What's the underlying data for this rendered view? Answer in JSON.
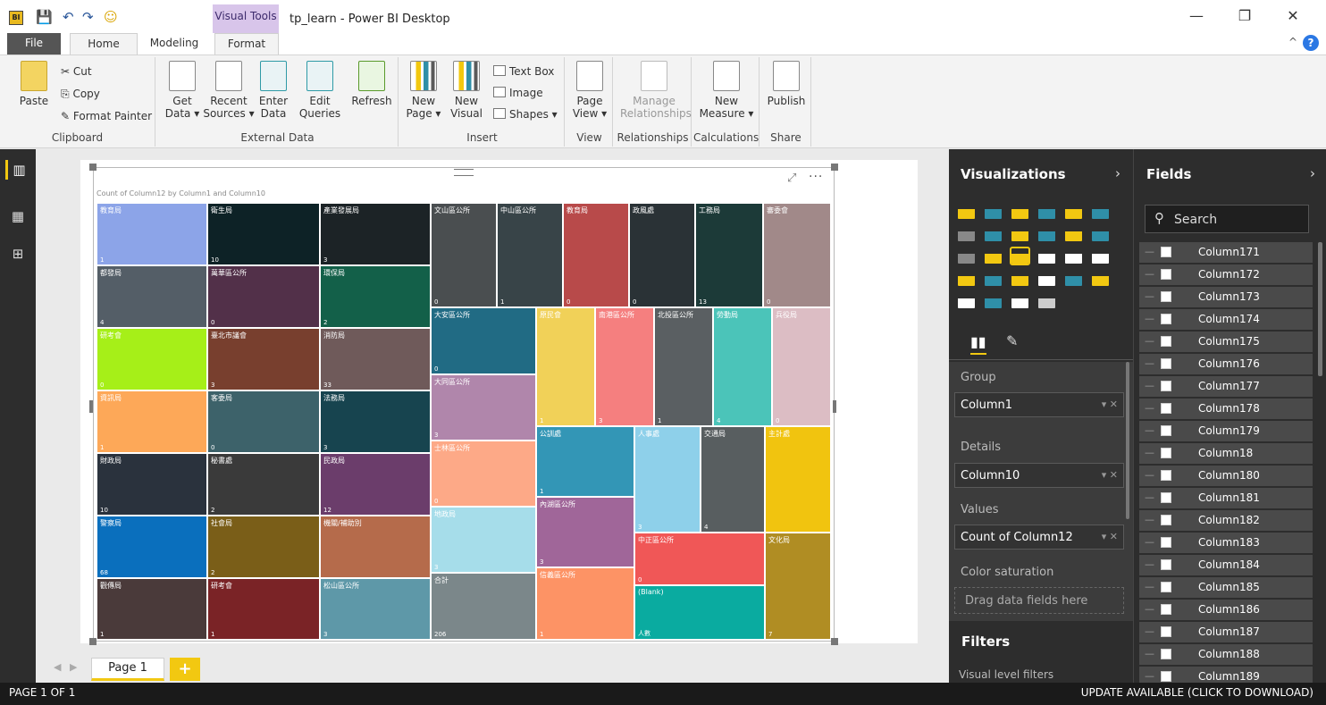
{
  "app": {
    "title": "tp_learn - Power BI Desktop",
    "contextual_tab": "Visual Tools"
  },
  "tabs": [
    "File",
    "Home",
    "Modeling",
    "Format"
  ],
  "ribbon": {
    "clipboard": {
      "label": "Clipboard",
      "paste": "Paste",
      "cut": "Cut",
      "copy": "Copy",
      "format_painter": "Format Painter"
    },
    "external_data": {
      "label": "External Data",
      "get_data": [
        "Get",
        "Data ▾"
      ],
      "recent_sources": [
        "Recent",
        "Sources ▾"
      ],
      "enter_data": [
        "Enter",
        "Data"
      ],
      "edit_queries": [
        "Edit",
        "Queries"
      ],
      "refresh": "Refresh"
    },
    "insert": {
      "label": "Insert",
      "new_page": [
        "New",
        "Page ▾"
      ],
      "new_visual": [
        "New",
        "Visual"
      ],
      "text_box": "Text Box",
      "image": "Image",
      "shapes": "Shapes ▾"
    },
    "view": {
      "label": "View",
      "page_view": [
        "Page",
        "View ▾"
      ]
    },
    "relationships": {
      "label": "Relationships",
      "manage": [
        "Manage",
        "Relationships"
      ]
    },
    "calculations": {
      "label": "Calculations",
      "new_measure": [
        "New",
        "Measure ▾"
      ]
    },
    "share": {
      "label": "Share",
      "publish": "Publish"
    }
  },
  "icons": {
    "cut": "✂",
    "copy": "⎘",
    "format_painter": "✎",
    "undo": "↶",
    "redo": "↷",
    "save": "💾",
    "smiley": "☺",
    "focus": "⤢",
    "more": "···",
    "search": "⚲",
    "chevron_right": "›",
    "minimize": "—",
    "restore": "❐",
    "close": "✕",
    "help": "?",
    "collapse": "^",
    "add": "+",
    "prev": "◀",
    "next": "▶"
  },
  "colors": {
    "accent": "#f2c811",
    "pane_bg": "#2d2d2d",
    "contextual_tab": "#d8c5ea"
  },
  "visual": {
    "title": "Count of Column12 by Column1 and Column10"
  },
  "chart_data": {
    "type": "treemap",
    "title": "Count of Column12 by Column1 and Column10",
    "cells": [
      {
        "label": "教育局",
        "value": "1",
        "color": "#8ca4e8"
      },
      {
        "label": "衛生局",
        "value": "10",
        "color": "#0d2226"
      },
      {
        "label": "產業發展局",
        "value": "3",
        "color": "#1c2326"
      },
      {
        "label": "都發局",
        "value": "4",
        "color": "#545e67"
      },
      {
        "label": "萬華區公所",
        "value": "0",
        "color": "#523049"
      },
      {
        "label": "環保局",
        "value": "2",
        "color": "#136049"
      },
      {
        "label": "研考會",
        "value": "0",
        "color": "#a6ef18"
      },
      {
        "label": "臺北市議會",
        "value": "3",
        "color": "#783f2e"
      },
      {
        "label": "消防局",
        "value": "33",
        "color": "#6f5a5a"
      },
      {
        "label": "資訊局",
        "value": "1",
        "color": "#fda858"
      },
      {
        "label": "客委局",
        "value": "0",
        "color": "#3d626a"
      },
      {
        "label": "法務局",
        "value": "3",
        "color": "#17444f"
      },
      {
        "label": "財政局",
        "value": "10",
        "color": "#2a323d"
      },
      {
        "label": "秘書處",
        "value": "2",
        "color": "#3a3a3a"
      },
      {
        "label": "民政局",
        "value": "12",
        "color": "#6b3d6b"
      },
      {
        "label": "警察局",
        "value": "68",
        "color": "#0a6fbd"
      },
      {
        "label": "社會局",
        "value": "2",
        "color": "#7a5e18"
      },
      {
        "label": "機關/補助別",
        "value": "",
        "color": "#b56b4b"
      },
      {
        "label": "觀傳局",
        "value": "1",
        "color": "#4a3a3a"
      },
      {
        "label": "研考會",
        "value": "1",
        "color": "#7a2326"
      },
      {
        "label": "松山區公所",
        "value": "3",
        "color": "#5e98a8"
      },
      {
        "label": "文山區公所",
        "value": "0",
        "color": "#4a4e50"
      },
      {
        "label": "中山區公所",
        "value": "1",
        "color": "#384448"
      },
      {
        "label": "教育局",
        "value": "0",
        "color": "#b84a4a"
      },
      {
        "label": "政風處",
        "value": "0",
        "color": "#2a3236"
      },
      {
        "label": "工務局",
        "value": "13",
        "color": "#1c3a38"
      },
      {
        "label": "審委會",
        "value": "0",
        "color": "#a18989"
      },
      {
        "label": "大安區公所",
        "value": "0",
        "color": "#216b84"
      },
      {
        "label": "原民會",
        "value": "1",
        "color": "#f1d158"
      },
      {
        "label": "南港區公所",
        "value": "3",
        "color": "#f57f7f"
      },
      {
        "label": "北投區公所",
        "value": "1",
        "color": "#5a5f62"
      },
      {
        "label": "勞動局",
        "value": "4",
        "color": "#4bc4b9"
      },
      {
        "label": "兵役局",
        "value": "0",
        "color": "#dcbdc4"
      },
      {
        "label": "大同區公所",
        "value": "3",
        "color": "#b086ab"
      },
      {
        "label": "公訓處",
        "value": "1",
        "color": "#3396b6"
      },
      {
        "label": "人事處",
        "value": "3",
        "color": "#8ed0ea"
      },
      {
        "label": "交通局",
        "value": "4",
        "color": "#585e60"
      },
      {
        "label": "主計處",
        "value": "",
        "color": "#f1c40f"
      },
      {
        "label": "士林區公所",
        "value": "0",
        "color": "#fda987"
      },
      {
        "label": "內湖區公所",
        "value": "3",
        "color": "#a06699"
      },
      {
        "label": "地政局",
        "value": "3",
        "color": "#a6ddea"
      },
      {
        "label": "中正區公所",
        "value": "0",
        "color": "#f05757"
      },
      {
        "label": "文化局",
        "value": "7",
        "color": "#b08d23"
      },
      {
        "label": "合計",
        "value": "206",
        "color": "#7b878a"
      },
      {
        "label": "信義區公所",
        "value": "1",
        "color": "#fd9365"
      },
      {
        "label": "(Blank)",
        "value": "人數",
        "color": "#0aaba0"
      }
    ]
  },
  "pages": {
    "tab": "Page 1",
    "status": "PAGE 1 OF 1",
    "update": "UPDATE AVAILABLE (CLICK TO DOWNLOAD)"
  },
  "visualizations": {
    "title": "Visualizations",
    "wells": {
      "group_label": "Group",
      "group_value": "Column1",
      "details_label": "Details",
      "details_value": "Column10",
      "values_label": "Values",
      "values_value": "Count of Column12",
      "saturation_label": "Color saturation",
      "saturation_placeholder": "Drag data fields here"
    },
    "filters_title": "Filters",
    "visual_filters": "Visual level filters"
  },
  "fields": {
    "title": "Fields",
    "search_placeholder": "Search",
    "items": [
      "Column171",
      "Column172",
      "Column173",
      "Column174",
      "Column175",
      "Column176",
      "Column177",
      "Column178",
      "Column179",
      "Column18",
      "Column180",
      "Column181",
      "Column182",
      "Column183",
      "Column184",
      "Column185",
      "Column186",
      "Column187",
      "Column188",
      "Column189"
    ]
  }
}
